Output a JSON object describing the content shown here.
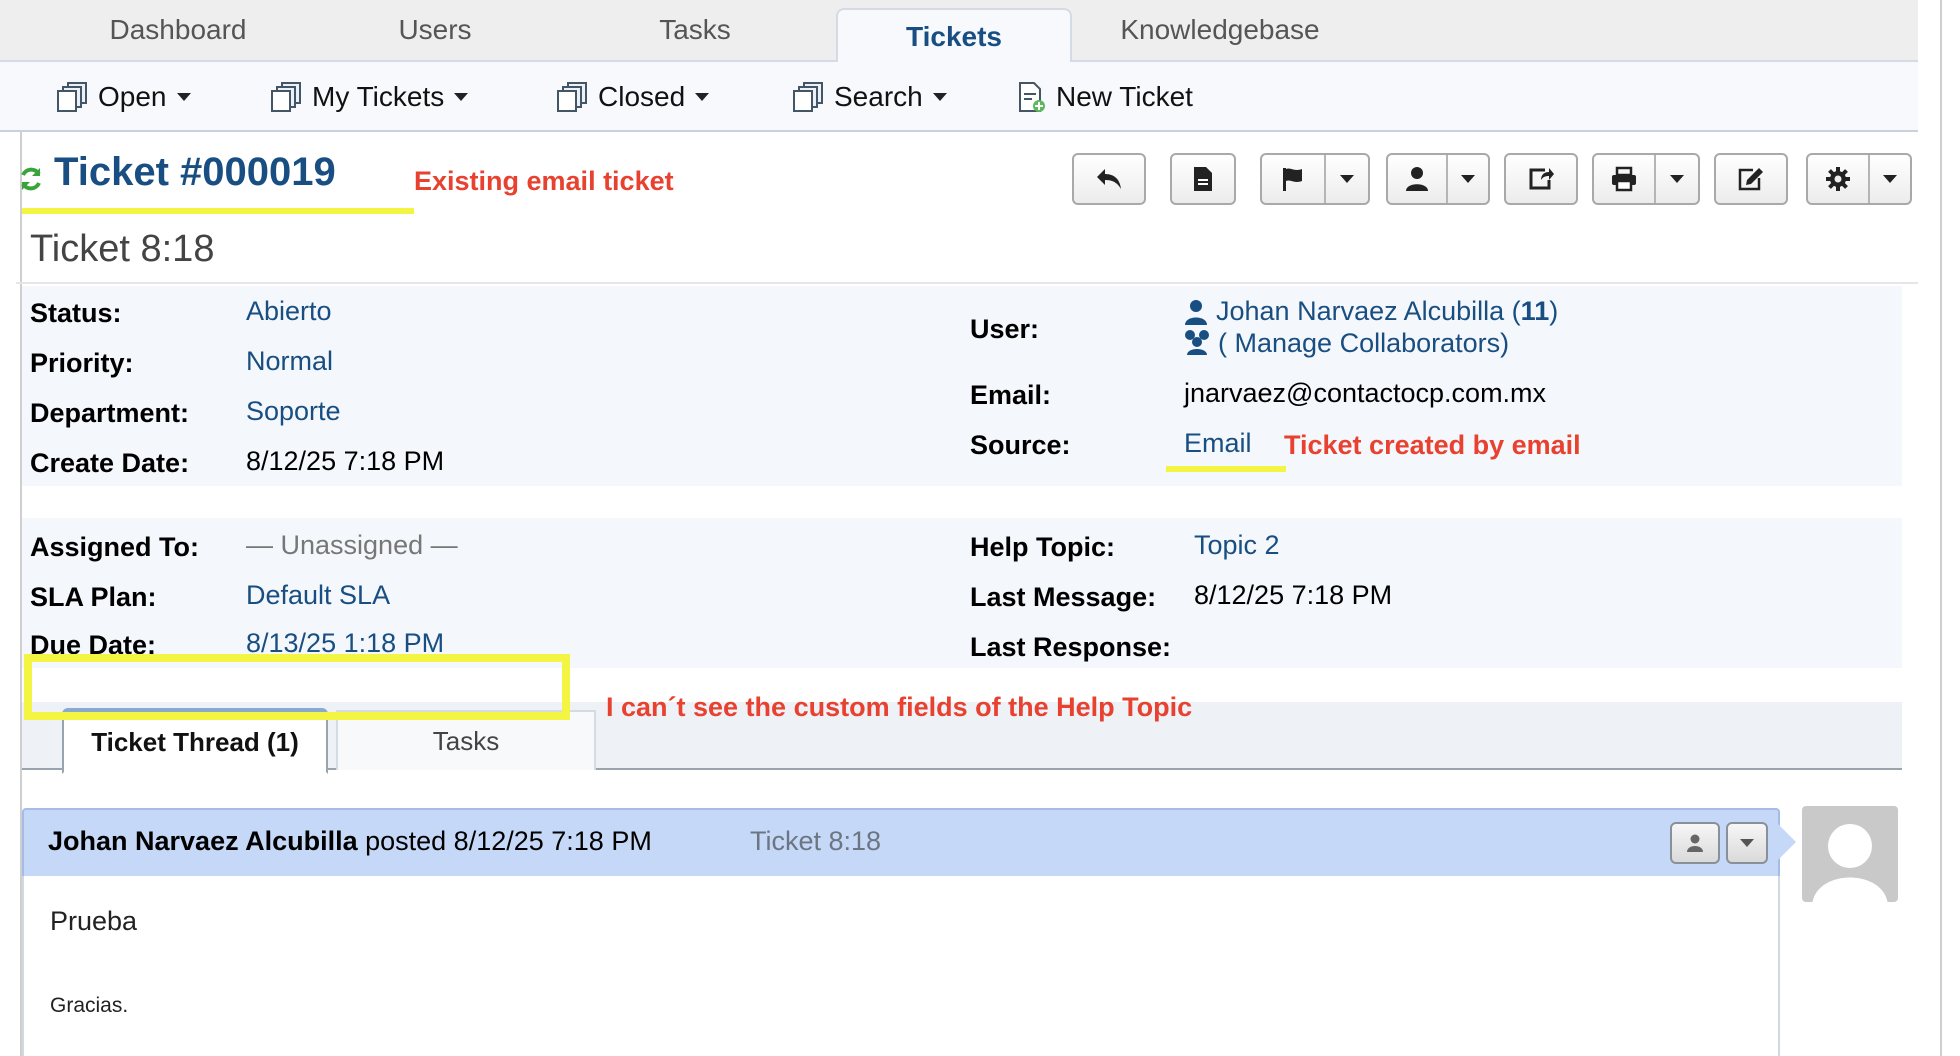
{
  "nav": {
    "tabs": [
      "Dashboard",
      "Users",
      "Tasks",
      "Tickets",
      "Knowledgebase"
    ],
    "active": "Tickets"
  },
  "subnav": {
    "open": "Open",
    "my_tickets": "My Tickets",
    "closed": "Closed",
    "search": "Search",
    "new_ticket": "New Ticket"
  },
  "ticket": {
    "number": "Ticket #000019",
    "subject": "Ticket 8:18"
  },
  "annotations": {
    "existing": "Existing email ticket",
    "created_by_email": "Ticket created by email",
    "custom_fields": "I can´t see the custom fields of the Help Topic"
  },
  "info": {
    "status_label": "Status:",
    "status": "Abierto",
    "priority_label": "Priority:",
    "priority": "Normal",
    "department_label": "Department:",
    "department": "Soporte",
    "create_date_label": "Create Date:",
    "create_date": "8/12/25 7:18 PM",
    "user_label": "User:",
    "user_name": "Johan Narvaez Alcubilla",
    "user_count_open": " (",
    "user_count": "11",
    "user_count_close": ")",
    "collaborators": "( Manage Collaborators)",
    "email_label": "Email:",
    "email": "jnarvaez@contactocp.com.mx",
    "source_label": "Source:",
    "source": "Email",
    "assigned_label": "Assigned To:",
    "assigned": "— Unassigned —",
    "sla_label": "SLA Plan:",
    "sla": "Default SLA",
    "due_label": "Due Date:",
    "due": "8/13/25 1:18 PM",
    "help_topic_label": "Help Topic:",
    "help_topic": "Topic 2",
    "last_message_label": "Last Message:",
    "last_message": "8/12/25 7:18 PM",
    "last_response_label": "Last Response:"
  },
  "thread_tabs": {
    "thread": "Ticket Thread (1)",
    "tasks": "Tasks"
  },
  "entry": {
    "author": "Johan Narvaez Alcubilla",
    "posted": " posted 8/12/25 7:18 PM",
    "title": "Ticket 8:18",
    "line1": "Prueba",
    "line2": "Gracias."
  },
  "colors": {
    "link": "#184e81",
    "annotation": "#e8412f",
    "highlight": "#f4f443",
    "entry_header": "#c6d8f7"
  }
}
